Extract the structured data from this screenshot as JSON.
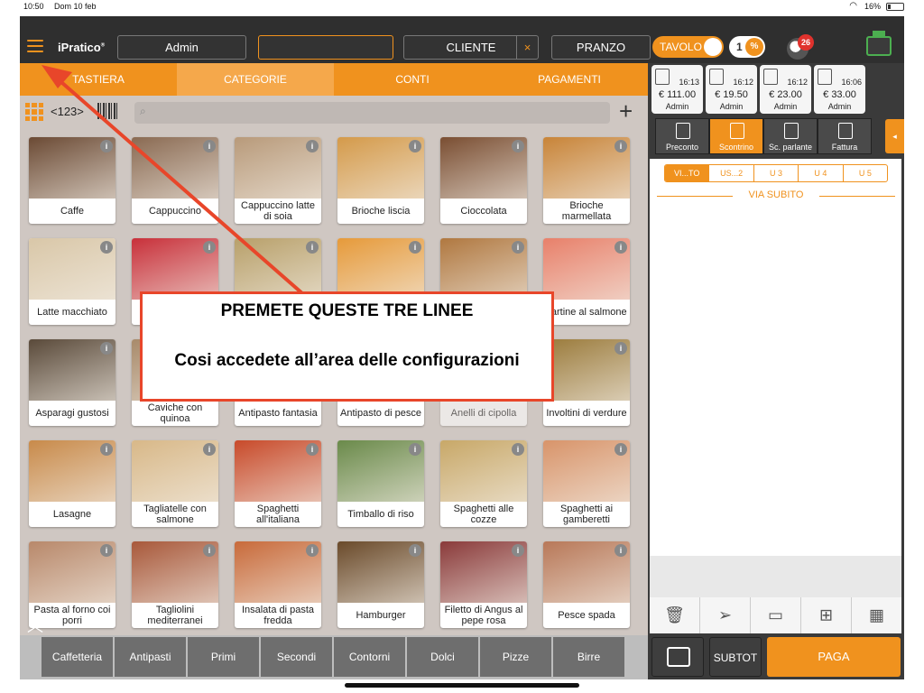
{
  "status_bar": {
    "time": "10:50",
    "date": "Dom 10 feb",
    "battery": "16%",
    "battery_fraction": 0.16
  },
  "header": {
    "brand": "iPratico",
    "brand_mark": "®",
    "user": "Admin",
    "empty_field": "",
    "customer": "CLIENTE",
    "clear_symbol": "×",
    "service": "PRANZO",
    "table_toggle": "TAVOLO",
    "table_count": "1",
    "percent_symbol": "%",
    "notifications": "26"
  },
  "tabs": [
    {
      "label": "TASTIERA",
      "active": false
    },
    {
      "label": "CATEGORIE",
      "active": true
    },
    {
      "label": "CONTI",
      "active": false
    },
    {
      "label": "PAGAMENTI",
      "active": false
    }
  ],
  "toolbar": {
    "number_label": "<123>",
    "plus": "+",
    "info_symbol": "i"
  },
  "products": [
    {
      "label": "Caffe",
      "color": "#6b4a34",
      "dim": false
    },
    {
      "label": "Cappuccino",
      "color": "#8a6a52",
      "dim": false
    },
    {
      "label": "Cappuccino latte di soia",
      "color": "#b89a7a",
      "dim": false
    },
    {
      "label": "Brioche liscia",
      "color": "#d49a4a",
      "dim": false
    },
    {
      "label": "Cioccolata",
      "color": "#7a4e32",
      "dim": false
    },
    {
      "label": "Brioche marmellata",
      "color": "#c88438",
      "dim": false
    },
    {
      "label": "Latte macchiato",
      "color": "#d9c7a8",
      "dim": false
    },
    {
      "label": "",
      "color": "#c8303a",
      "dim": false
    },
    {
      "label": "",
      "color": "#b8a06a",
      "dim": false
    },
    {
      "label": "",
      "color": "#e69a3a",
      "dim": false
    },
    {
      "label": "",
      "color": "#b07840",
      "dim": false
    },
    {
      "label": "Tartine al salmone",
      "color": "#e8806a",
      "dim": false
    },
    {
      "label": "Asparagi gustosi",
      "color": "#5a4a3a",
      "dim": false
    },
    {
      "label": "Caviche con quinoa",
      "color": "#a88a6a",
      "dim": false
    },
    {
      "label": "Antipasto fantasia",
      "color": "#c8a87a",
      "dim": false
    },
    {
      "label": "Antipasto di pesce",
      "color": "#d8c8a8",
      "dim": false
    },
    {
      "label": "Anelli di cipolla",
      "color": "#c89a5a",
      "dim": true
    },
    {
      "label": "Involtini di verdure",
      "color": "#9a7a3a",
      "dim": false
    },
    {
      "label": "Lasagne",
      "color": "#c88a4a",
      "dim": false
    },
    {
      "label": "Tagliatelle con salmone",
      "color": "#d8b888",
      "dim": false
    },
    {
      "label": "Spaghetti all'italiana",
      "color": "#c84a2a",
      "dim": false
    },
    {
      "label": "Timballo di riso",
      "color": "#6a8a4a",
      "dim": false
    },
    {
      "label": "Spaghetti alle cozze",
      "color": "#c8a868",
      "dim": false
    },
    {
      "label": "Spaghetti ai gamberetti",
      "color": "#d8946a",
      "dim": false
    },
    {
      "label": "Pasta al forno coi porri",
      "color": "#b8886a",
      "dim": false
    },
    {
      "label": "Tagliolini mediterranei",
      "color": "#a8583a",
      "dim": false
    },
    {
      "label": "Insalata di pasta fredda",
      "color": "#c86a3a",
      "dim": false
    },
    {
      "label": "Hamburger",
      "color": "#6a4a2a",
      "dim": false
    },
    {
      "label": "Filetto di Angus al pepe rosa",
      "color": "#8a3a3a",
      "dim": false
    },
    {
      "label": "Pesce spada",
      "color": "#b87858",
      "dim": false
    }
  ],
  "categories": [
    "Caffetteria",
    "Antipasti",
    "Primi",
    "Secondi",
    "Contorni",
    "Dolci",
    "Pizze",
    "Birre"
  ],
  "open_tables": [
    {
      "time": "16:13",
      "amount": "€ 111.00",
      "user": "Admin"
    },
    {
      "time": "16:12",
      "amount": "€ 19.50",
      "user": "Admin"
    },
    {
      "time": "16:12",
      "amount": "€ 23.00",
      "user": "Admin"
    },
    {
      "time": "16:06",
      "amount": "€ 33.00",
      "user": "Admin"
    }
  ],
  "documents": [
    {
      "label": "Preconto",
      "active": false
    },
    {
      "label": "Scontrino",
      "active": true
    },
    {
      "label": "Sc. parlante",
      "active": false
    },
    {
      "label": "Fattura",
      "active": false
    }
  ],
  "order_tabs": [
    "VI...TO",
    "US...2",
    "U 3",
    "U 4",
    "U 5"
  ],
  "order_section": "VIA SUBITO",
  "bottom": {
    "subtot": "SUBTOT",
    "pay": "PAGA"
  },
  "callout": {
    "line1": "PREMETE QUESTE TRE LINEE",
    "line2": "Cosi accedete all’area delle configurazioni"
  },
  "colors": {
    "accent": "#f0921e",
    "callout_border": "#e8462a",
    "arrow": "#e8462a"
  }
}
